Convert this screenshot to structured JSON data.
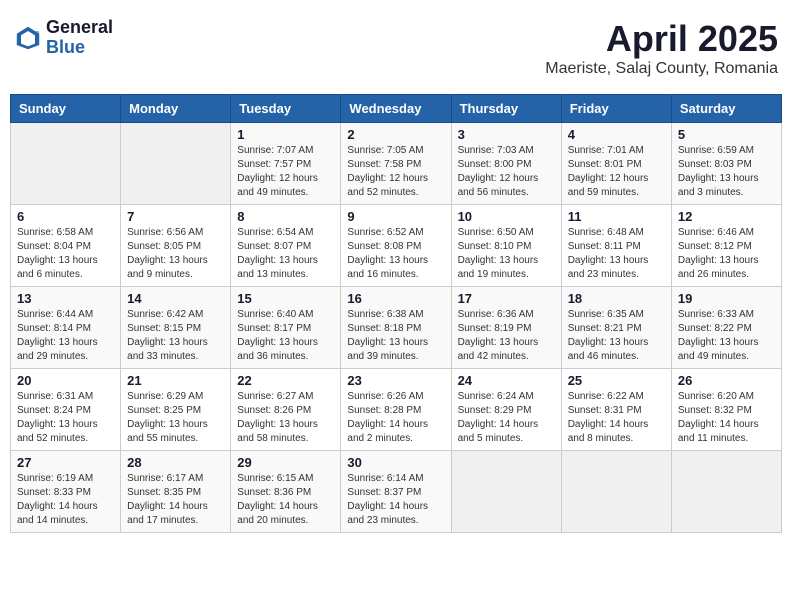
{
  "header": {
    "logo_general": "General",
    "logo_blue": "Blue",
    "month": "April 2025",
    "location": "Maeriste, Salaj County, Romania"
  },
  "weekdays": [
    "Sunday",
    "Monday",
    "Tuesday",
    "Wednesday",
    "Thursday",
    "Friday",
    "Saturday"
  ],
  "weeks": [
    [
      {
        "day": "",
        "info": ""
      },
      {
        "day": "",
        "info": ""
      },
      {
        "day": "1",
        "info": "Sunrise: 7:07 AM\nSunset: 7:57 PM\nDaylight: 12 hours and 49 minutes."
      },
      {
        "day": "2",
        "info": "Sunrise: 7:05 AM\nSunset: 7:58 PM\nDaylight: 12 hours and 52 minutes."
      },
      {
        "day": "3",
        "info": "Sunrise: 7:03 AM\nSunset: 8:00 PM\nDaylight: 12 hours and 56 minutes."
      },
      {
        "day": "4",
        "info": "Sunrise: 7:01 AM\nSunset: 8:01 PM\nDaylight: 12 hours and 59 minutes."
      },
      {
        "day": "5",
        "info": "Sunrise: 6:59 AM\nSunset: 8:03 PM\nDaylight: 13 hours and 3 minutes."
      }
    ],
    [
      {
        "day": "6",
        "info": "Sunrise: 6:58 AM\nSunset: 8:04 PM\nDaylight: 13 hours and 6 minutes."
      },
      {
        "day": "7",
        "info": "Sunrise: 6:56 AM\nSunset: 8:05 PM\nDaylight: 13 hours and 9 minutes."
      },
      {
        "day": "8",
        "info": "Sunrise: 6:54 AM\nSunset: 8:07 PM\nDaylight: 13 hours and 13 minutes."
      },
      {
        "day": "9",
        "info": "Sunrise: 6:52 AM\nSunset: 8:08 PM\nDaylight: 13 hours and 16 minutes."
      },
      {
        "day": "10",
        "info": "Sunrise: 6:50 AM\nSunset: 8:10 PM\nDaylight: 13 hours and 19 minutes."
      },
      {
        "day": "11",
        "info": "Sunrise: 6:48 AM\nSunset: 8:11 PM\nDaylight: 13 hours and 23 minutes."
      },
      {
        "day": "12",
        "info": "Sunrise: 6:46 AM\nSunset: 8:12 PM\nDaylight: 13 hours and 26 minutes."
      }
    ],
    [
      {
        "day": "13",
        "info": "Sunrise: 6:44 AM\nSunset: 8:14 PM\nDaylight: 13 hours and 29 minutes."
      },
      {
        "day": "14",
        "info": "Sunrise: 6:42 AM\nSunset: 8:15 PM\nDaylight: 13 hours and 33 minutes."
      },
      {
        "day": "15",
        "info": "Sunrise: 6:40 AM\nSunset: 8:17 PM\nDaylight: 13 hours and 36 minutes."
      },
      {
        "day": "16",
        "info": "Sunrise: 6:38 AM\nSunset: 8:18 PM\nDaylight: 13 hours and 39 minutes."
      },
      {
        "day": "17",
        "info": "Sunrise: 6:36 AM\nSunset: 8:19 PM\nDaylight: 13 hours and 42 minutes."
      },
      {
        "day": "18",
        "info": "Sunrise: 6:35 AM\nSunset: 8:21 PM\nDaylight: 13 hours and 46 minutes."
      },
      {
        "day": "19",
        "info": "Sunrise: 6:33 AM\nSunset: 8:22 PM\nDaylight: 13 hours and 49 minutes."
      }
    ],
    [
      {
        "day": "20",
        "info": "Sunrise: 6:31 AM\nSunset: 8:24 PM\nDaylight: 13 hours and 52 minutes."
      },
      {
        "day": "21",
        "info": "Sunrise: 6:29 AM\nSunset: 8:25 PM\nDaylight: 13 hours and 55 minutes."
      },
      {
        "day": "22",
        "info": "Sunrise: 6:27 AM\nSunset: 8:26 PM\nDaylight: 13 hours and 58 minutes."
      },
      {
        "day": "23",
        "info": "Sunrise: 6:26 AM\nSunset: 8:28 PM\nDaylight: 14 hours and 2 minutes."
      },
      {
        "day": "24",
        "info": "Sunrise: 6:24 AM\nSunset: 8:29 PM\nDaylight: 14 hours and 5 minutes."
      },
      {
        "day": "25",
        "info": "Sunrise: 6:22 AM\nSunset: 8:31 PM\nDaylight: 14 hours and 8 minutes."
      },
      {
        "day": "26",
        "info": "Sunrise: 6:20 AM\nSunset: 8:32 PM\nDaylight: 14 hours and 11 minutes."
      }
    ],
    [
      {
        "day": "27",
        "info": "Sunrise: 6:19 AM\nSunset: 8:33 PM\nDaylight: 14 hours and 14 minutes."
      },
      {
        "day": "28",
        "info": "Sunrise: 6:17 AM\nSunset: 8:35 PM\nDaylight: 14 hours and 17 minutes."
      },
      {
        "day": "29",
        "info": "Sunrise: 6:15 AM\nSunset: 8:36 PM\nDaylight: 14 hours and 20 minutes."
      },
      {
        "day": "30",
        "info": "Sunrise: 6:14 AM\nSunset: 8:37 PM\nDaylight: 14 hours and 23 minutes."
      },
      {
        "day": "",
        "info": ""
      },
      {
        "day": "",
        "info": ""
      },
      {
        "day": "",
        "info": ""
      }
    ]
  ]
}
